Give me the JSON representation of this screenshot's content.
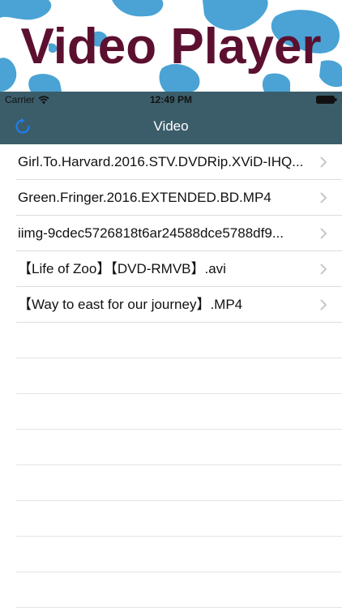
{
  "banner": {
    "title": "Video Player",
    "title_color": "#5c1030",
    "spot_color": "#4aa3d4"
  },
  "status_bar": {
    "carrier": "Carrier",
    "time": "12:49 PM",
    "icons": [
      "wifi-icon",
      "battery-icon"
    ]
  },
  "nav": {
    "title": "Video",
    "background": "#3b5d6a",
    "left_icon": "refresh-icon",
    "accent": "#1e7cf0"
  },
  "videos": [
    {
      "label": "Girl.To.Harvard.2016.STV.DVDRip.XViD-IHQ..."
    },
    {
      "label": "Green.Fringer.2016.EXTENDED.BD.MP4"
    },
    {
      "label": "iimg-9cdec5726818t6ar24588dce5788df9..."
    },
    {
      "label": "【Life of Zoo】【DVD-RMVB】.avi"
    },
    {
      "label": "【Way to east for our journey】.MP4"
    }
  ]
}
